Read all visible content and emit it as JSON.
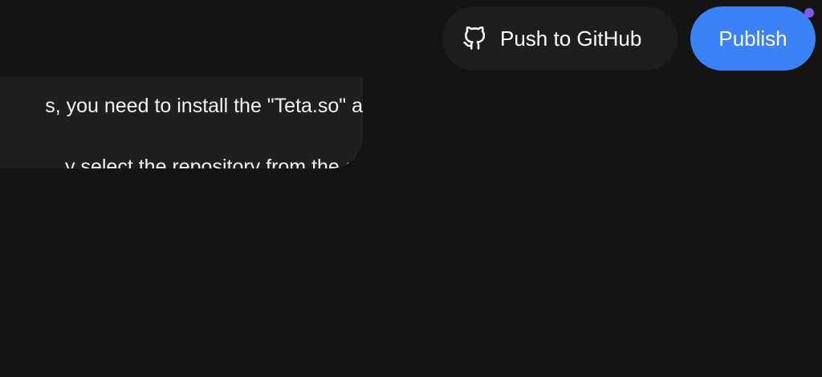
{
  "header": {
    "github_button_label": "Push to GitHub",
    "github_icon": "github-icon",
    "publish_button_label": "Publish",
    "accent_color": "#3b82f6",
    "notification_color": "#7c5cf0"
  },
  "message": {
    "line1": "s, you need to install the \"Teta.so\" a",
    "line2": "y select the repository from the dr"
  }
}
